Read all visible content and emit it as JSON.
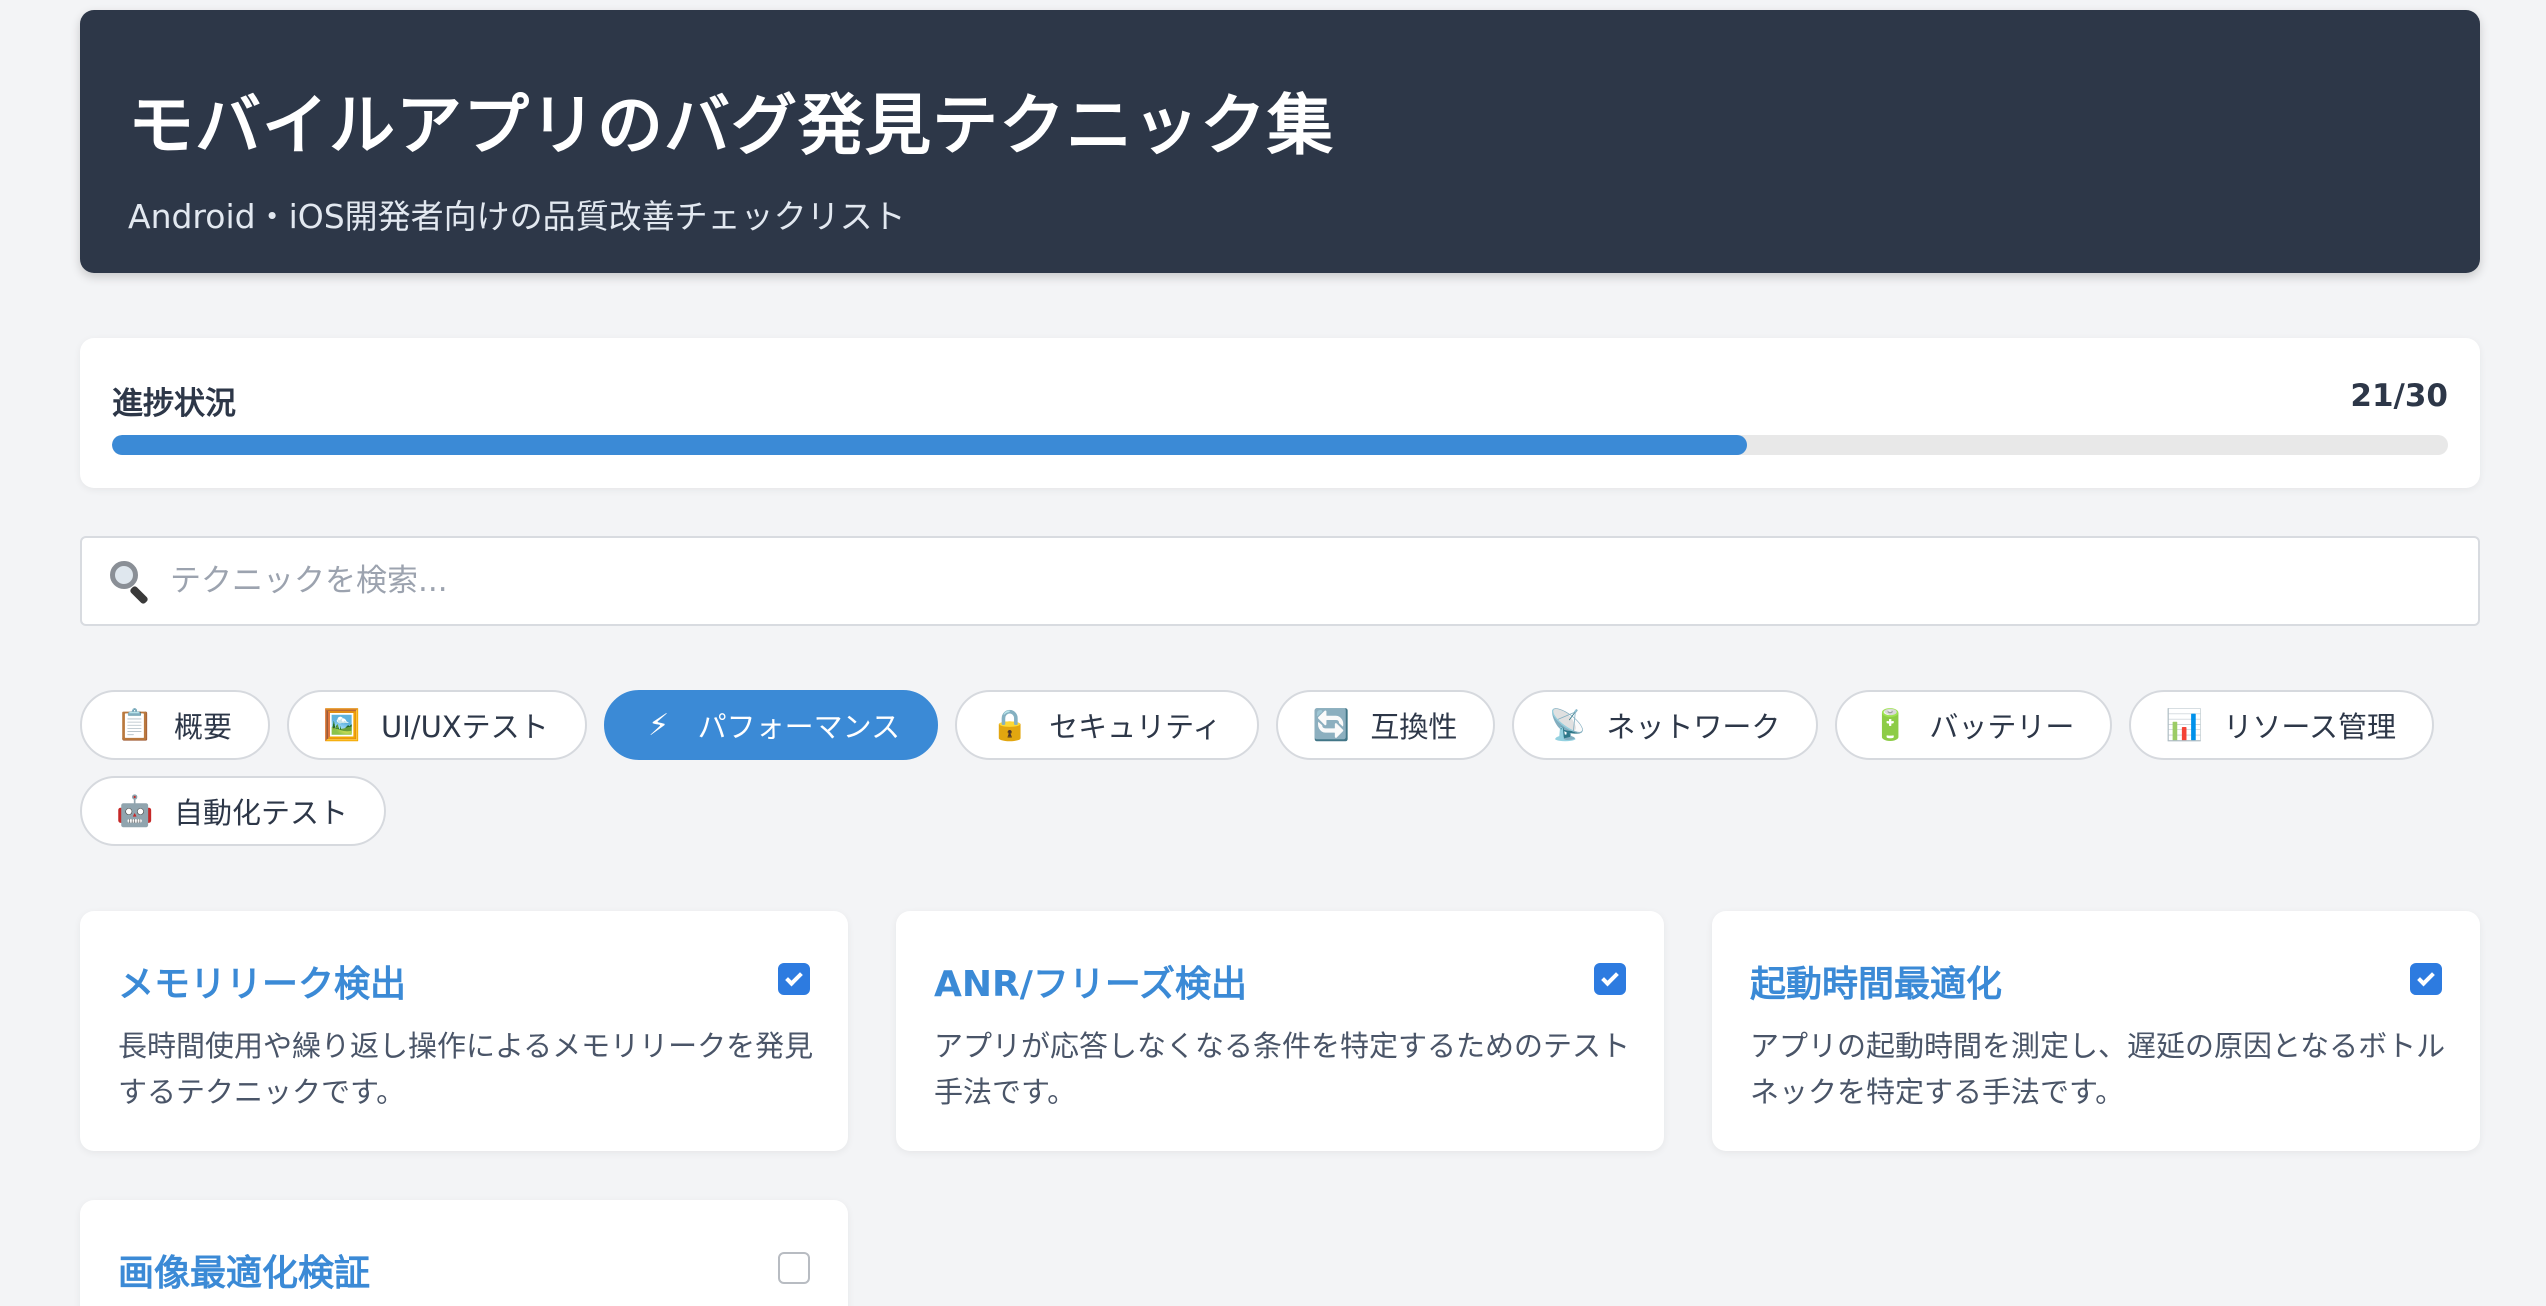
{
  "header": {
    "title": "モバイルアプリのバグ発見テクニック集",
    "subtitle": "Android・iOS開発者向けの品質改善チェックリスト"
  },
  "progress": {
    "label": "進捗状況",
    "count_text": "21/30",
    "completed": 21,
    "total": 30,
    "fraction": 0.7,
    "color": "#3b8ad6"
  },
  "search": {
    "icon": "search-icon",
    "placeholder": "テクニックを検索...",
    "value": ""
  },
  "tabs": [
    {
      "emoji": "📋",
      "icon": "clipboard-icon",
      "label": "概要",
      "active": false
    },
    {
      "emoji": "🖼️",
      "icon": "picture-icon",
      "label": "UI/UXテスト",
      "active": false
    },
    {
      "emoji": "⚡",
      "icon": "lightning-icon",
      "label": "パフォーマンス",
      "active": true
    },
    {
      "emoji": "🔒",
      "icon": "lock-icon",
      "label": "セキュリティ",
      "active": false
    },
    {
      "emoji": "🔄",
      "icon": "refresh-icon",
      "label": "互換性",
      "active": false
    },
    {
      "emoji": "📡",
      "icon": "satellite-icon",
      "label": "ネットワーク",
      "active": false
    },
    {
      "emoji": "🔋",
      "icon": "battery-icon",
      "label": "バッテリー",
      "active": false
    },
    {
      "emoji": "📊",
      "icon": "bar-chart-icon",
      "label": "リソース管理",
      "active": false
    },
    {
      "emoji": "🤖",
      "icon": "robot-icon",
      "label": "自動化テスト",
      "active": false
    }
  ],
  "cards": [
    {
      "title": "メモリリーク検出",
      "description": "長時間使用や繰り返し操作によるメモリリークを発見するテクニックです。",
      "checked": true
    },
    {
      "title": "ANR/フリーズ検出",
      "description": "アプリが応答しなくなる条件を特定するためのテスト手法です。",
      "checked": true
    },
    {
      "title": "起動時間最適化",
      "description": "アプリの起動時間を測定し、遅延の原因となるボトルネックを特定する手法です。",
      "checked": true
    },
    {
      "title": "画像最適化検証",
      "description": "",
      "checked": false
    }
  ],
  "colors": {
    "header_bg": "#2d3748",
    "accent": "#3b8ad6",
    "page_bg": "#f3f4f6"
  }
}
